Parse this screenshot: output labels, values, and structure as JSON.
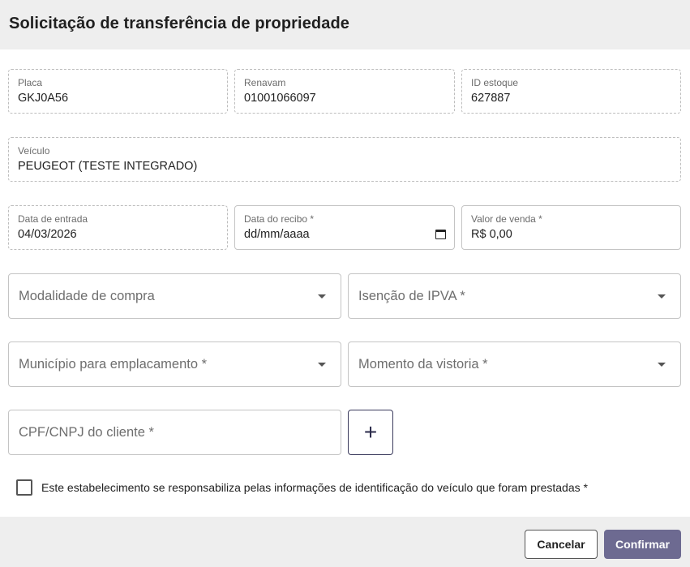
{
  "header": {
    "title": "Solicitação de transferência de propriedade"
  },
  "fields": {
    "placa": {
      "label": "Placa",
      "value": "GKJ0A56"
    },
    "renavam": {
      "label": "Renavam",
      "value": "01001066097"
    },
    "id_estoque": {
      "label": "ID estoque",
      "value": "627887"
    },
    "veiculo": {
      "label": "Veículo",
      "value": "PEUGEOT (TESTE INTEGRADO)"
    },
    "data_entrada": {
      "label": "Data de entrada",
      "value": "04/03/2026"
    },
    "data_recibo": {
      "label": "Data do recibo *",
      "placeholder": "dd/mm/aaaa"
    },
    "valor_venda": {
      "label": "Valor de venda *",
      "value": "R$ 0,00"
    },
    "modalidade": {
      "placeholder": "Modalidade de compra"
    },
    "isencao_ipva": {
      "placeholder": "Isenção de IPVA *"
    },
    "municipio": {
      "placeholder": "Município para emplacamento *"
    },
    "momento_vistoria": {
      "placeholder": "Momento da vistoria *"
    },
    "cpf_cnpj": {
      "placeholder": "CPF/CNPJ do cliente *"
    }
  },
  "add_button": {
    "label": "+"
  },
  "checkbox": {
    "label": "Este estabelecimento se responsabiliza pelas informações de identificação do veículo que foram prestadas *",
    "checked": false
  },
  "footer": {
    "cancel_label": "Cancelar",
    "confirm_label": "Confirmar"
  },
  "colors": {
    "header_bg": "#eeeeee",
    "confirm_bg": "#6d6a91",
    "add_border": "#3a3a5c"
  }
}
